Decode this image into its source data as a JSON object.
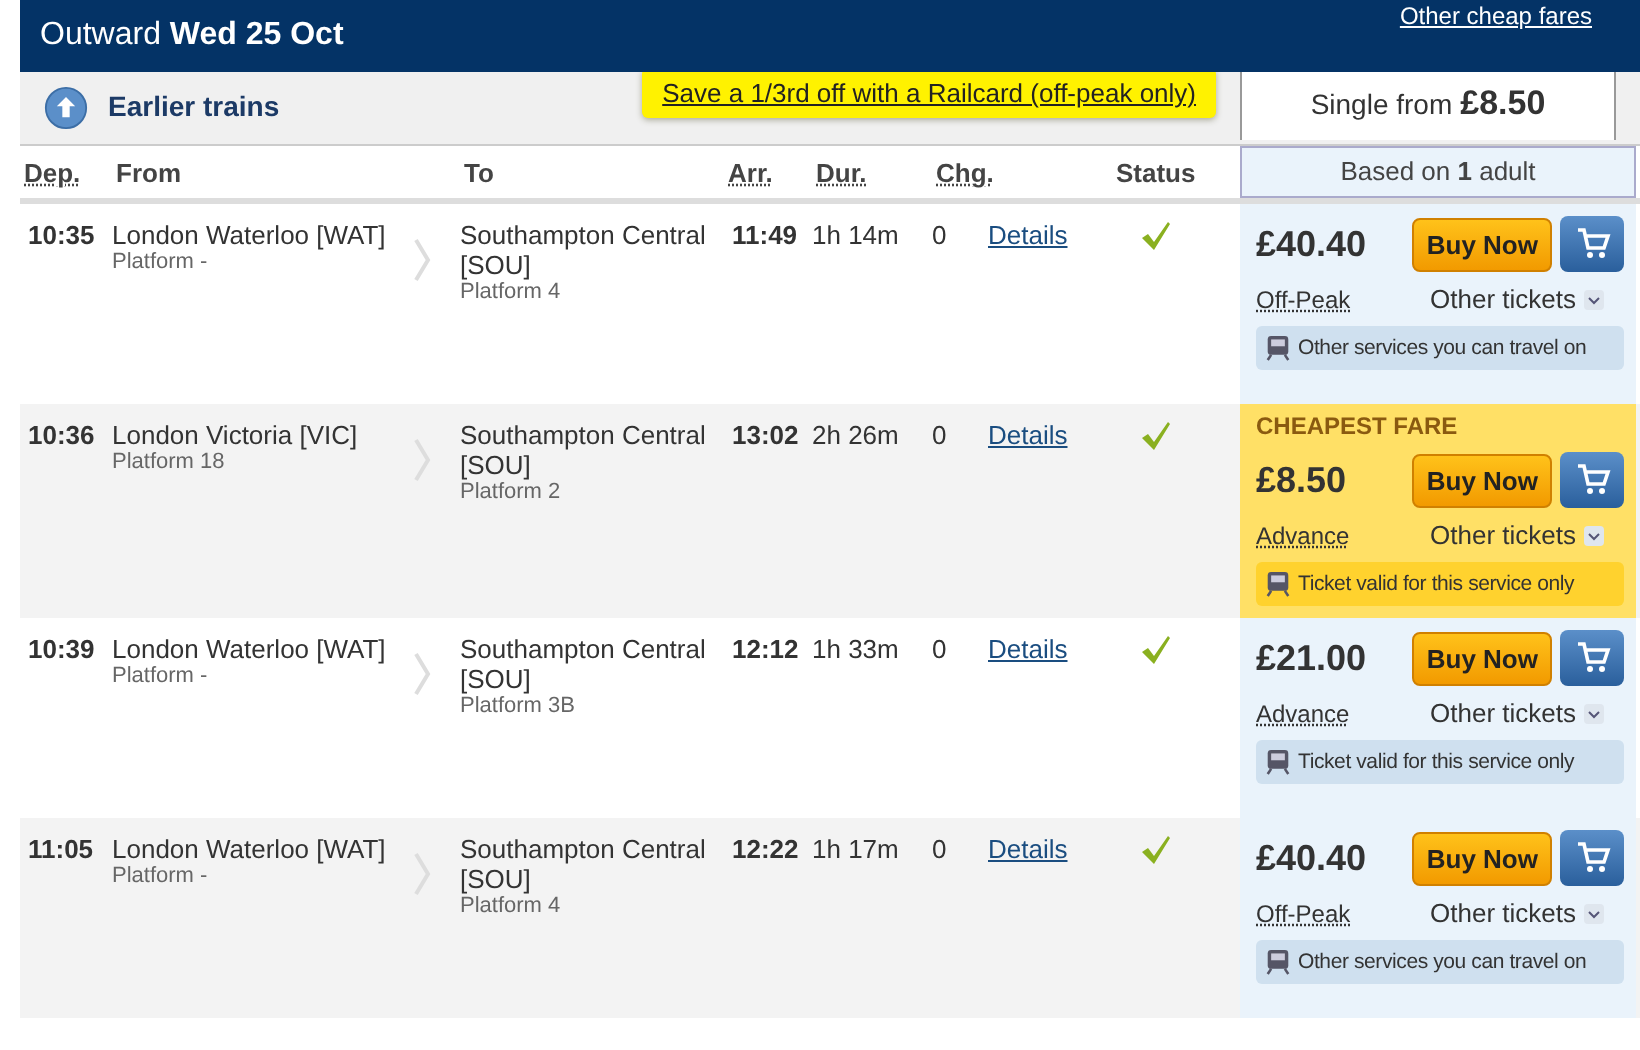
{
  "header": {
    "title": "Outward **Wed 25 Oct**",
    "link": "Other cheap fares"
  },
  "toolbar": {
    "earlier": "Earlier trains",
    "railcard": "Save a 1/3rd off with a Railcard (off-peak only)",
    "single_from": "Single from **£8.50**"
  },
  "columns": {
    "dep": "Dep.",
    "from": "From",
    "to": "To",
    "arr": "Arr.",
    "dur": "Dur.",
    "chg": "Chg.",
    "status": "Status",
    "fare": "Based on **1** adult"
  },
  "rows": [
    {
      "dep": "10:35",
      "from": "London Waterloo [WAT]",
      "from_platform": "Platform -",
      "to": "Southampton Central [SOU]",
      "to_platform": "Platform 4",
      "arr": "11:49",
      "dur": "1h 14m",
      "chg": "0",
      "details": "Details",
      "on_time": true,
      "fare": {
        "cheapest": false,
        "price": "£40.40",
        "buy": "Buy Now",
        "type": "Off-Peak",
        "other": "Other tickets",
        "note": "Other services you can travel on"
      }
    },
    {
      "dep": "10:36",
      "from": "London Victoria [VIC]",
      "from_platform": "Platform 18",
      "to": "Southampton Central [SOU]",
      "to_platform": "Platform 2",
      "arr": "13:02",
      "dur": "2h 26m",
      "chg": "0",
      "details": "Details",
      "on_time": true,
      "fare": {
        "cheapest": true,
        "banner": "CHEAPEST FARE",
        "price": "£8.50",
        "buy": "Buy Now",
        "type": "Advance",
        "other": "Other tickets",
        "note": "Ticket valid for this service only"
      }
    },
    {
      "dep": "10:39",
      "from": "London Waterloo [WAT]",
      "from_platform": "Platform -",
      "to": "Southampton Central [SOU]",
      "to_platform": "Platform 3B",
      "arr": "12:12",
      "dur": "1h 33m",
      "chg": "0",
      "details": "Details",
      "on_time": true,
      "fare": {
        "cheapest": false,
        "price": "£21.00",
        "buy": "Buy Now",
        "type": "Advance",
        "other": "Other tickets",
        "note": "Ticket valid for this service only"
      }
    },
    {
      "dep": "11:05",
      "from": "London Waterloo [WAT]",
      "from_platform": "Platform -",
      "to": "Southampton Central [SOU]",
      "to_platform": "Platform 4",
      "arr": "12:22",
      "dur": "1h 17m",
      "chg": "0",
      "details": "Details",
      "on_time": true,
      "fare": {
        "cheapest": false,
        "price": "£40.40",
        "buy": "Buy Now",
        "type": "Off-Peak",
        "other": "Other tickets",
        "note": "Other services you can travel on"
      }
    }
  ]
}
